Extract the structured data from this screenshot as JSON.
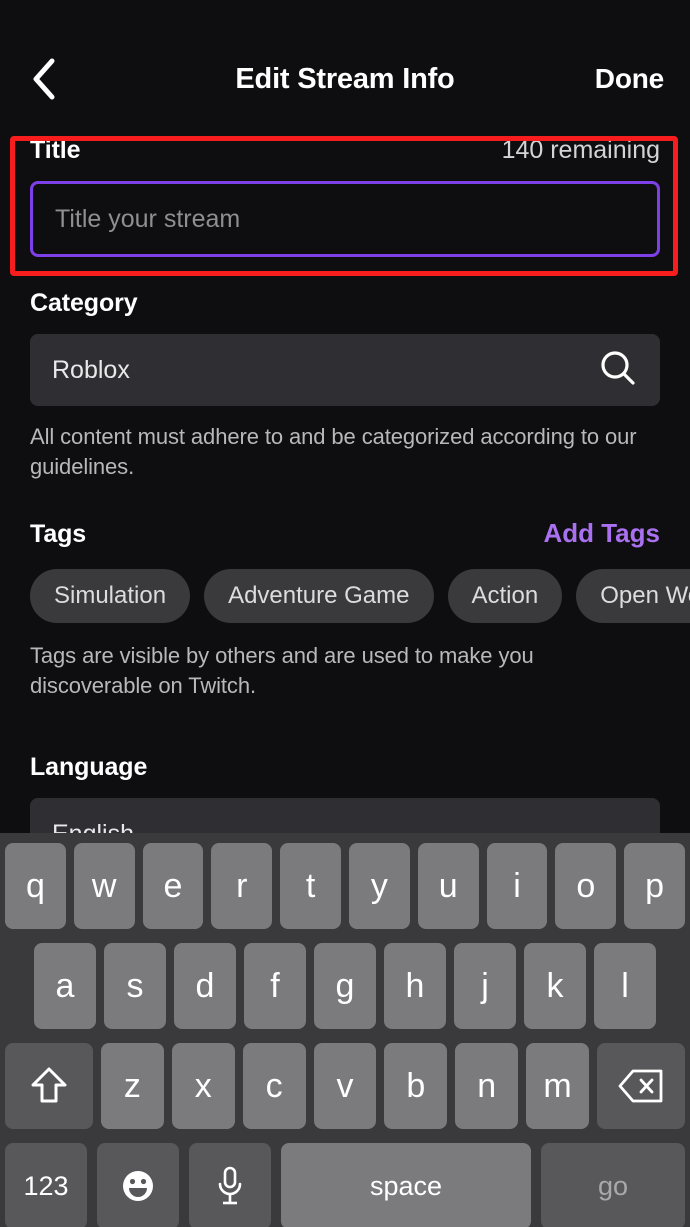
{
  "header": {
    "back_icon": "chevron-left-icon",
    "title": "Edit Stream Info",
    "done_label": "Done"
  },
  "title_section": {
    "label": "Title",
    "counter": "140 remaining",
    "input_placeholder": "Title your stream",
    "input_value": "",
    "focused": true,
    "focus_border_color": "#7d3fe8"
  },
  "annotation": {
    "color": "#f71d1d",
    "target": "title-section"
  },
  "category_section": {
    "label": "Category",
    "value": "Roblox",
    "search_icon": "search-icon",
    "helper": "All content must adhere to and be categorized according to our guidelines."
  },
  "tags_section": {
    "label": "Tags",
    "add_label": "Add Tags",
    "add_color": "#a970f0",
    "tags": [
      "Simulation",
      "Adventure Game",
      "Action",
      "Open World"
    ],
    "helper": "Tags are visible by others and are used to make you discoverable on Twitch."
  },
  "language_section": {
    "label": "Language",
    "value": "English"
  },
  "keyboard": {
    "row1": [
      "q",
      "w",
      "e",
      "r",
      "t",
      "y",
      "u",
      "i",
      "o",
      "p"
    ],
    "row2": [
      "a",
      "s",
      "d",
      "f",
      "g",
      "h",
      "j",
      "k",
      "l"
    ],
    "row3": [
      "z",
      "x",
      "c",
      "v",
      "b",
      "n",
      "m"
    ],
    "shift_icon": "shift-arrow-icon",
    "backspace_icon": "backspace-icon",
    "numbers_label": "123",
    "emoji_icon": "emoji-smiley-icon",
    "mic_icon": "microphone-icon",
    "space_label": "space",
    "go_label": "go"
  }
}
